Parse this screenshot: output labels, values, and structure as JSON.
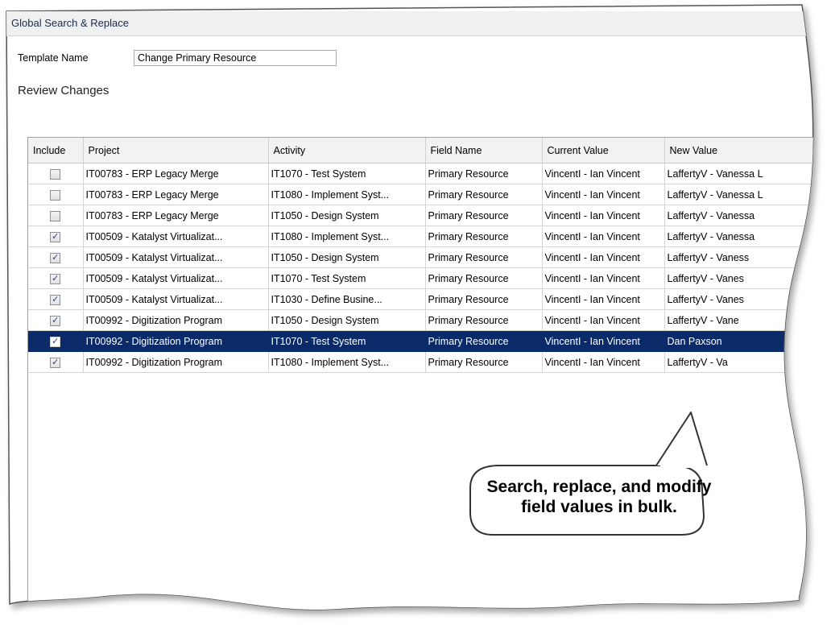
{
  "window": {
    "title": "Global Search & Replace"
  },
  "template": {
    "label": "Template Name",
    "value": "Change Primary Resource"
  },
  "review": {
    "heading": "Review Changes"
  },
  "table": {
    "columns": [
      "Include",
      "Project",
      "Activity",
      "Field Name",
      "Current Value",
      "New Value"
    ],
    "rows": [
      {
        "include": false,
        "selected": false,
        "project": "IT00783 - ERP Legacy Merge",
        "activity": "IT1070 - Test System",
        "field": "Primary Resource",
        "current": "VincentI - Ian Vincent",
        "new": "LaffertyV - Vanessa L"
      },
      {
        "include": false,
        "selected": false,
        "project": "IT00783 - ERP Legacy Merge",
        "activity": "IT1080 - Implement Syst...",
        "field": "Primary Resource",
        "current": "VincentI - Ian Vincent",
        "new": "LaffertyV - Vanessa L"
      },
      {
        "include": false,
        "selected": false,
        "project": "IT00783 - ERP Legacy Merge",
        "activity": "IT1050 - Design System",
        "field": "Primary Resource",
        "current": "VincentI - Ian Vincent",
        "new": "LaffertyV - Vanessa"
      },
      {
        "include": true,
        "selected": false,
        "project": "IT00509 - Katalyst Virtualizat...",
        "activity": "IT1080 - Implement Syst...",
        "field": "Primary Resource",
        "current": "VincentI - Ian Vincent",
        "new": "LaffertyV - Vanessa"
      },
      {
        "include": true,
        "selected": false,
        "project": "IT00509 - Katalyst Virtualizat...",
        "activity": "IT1050 - Design System",
        "field": "Primary Resource",
        "current": "VincentI - Ian Vincent",
        "new": "LaffertyV - Vaness"
      },
      {
        "include": true,
        "selected": false,
        "project": "IT00509 - Katalyst Virtualizat...",
        "activity": "IT1070 - Test System",
        "field": "Primary Resource",
        "current": "VincentI - Ian Vincent",
        "new": "LaffertyV - Vanes"
      },
      {
        "include": true,
        "selected": false,
        "project": "IT00509 - Katalyst Virtualizat...",
        "activity": "IT1030 - Define Busine...",
        "field": "Primary Resource",
        "current": "VincentI - Ian Vincent",
        "new": "LaffertyV - Vanes"
      },
      {
        "include": true,
        "selected": false,
        "project": "IT00992 - Digitization Program",
        "activity": "IT1050 - Design System",
        "field": "Primary Resource",
        "current": "VincentI - Ian Vincent",
        "new": "LaffertyV - Vane"
      },
      {
        "include": true,
        "selected": true,
        "project": "IT00992 - Digitization Program",
        "activity": "IT1070 - Test System",
        "field": "Primary Resource",
        "current": "VincentI - Ian Vincent",
        "new": "Dan Paxson"
      },
      {
        "include": true,
        "selected": false,
        "project": "IT00992 - Digitization Program",
        "activity": "IT1080 - Implement Syst...",
        "field": "Primary Resource",
        "current": "VincentI - Ian Vincent",
        "new": "LaffertyV - Va"
      }
    ]
  },
  "callout": {
    "text": "Search, replace, and modify field values in bulk."
  },
  "icons": {
    "checked": "checkbox-checked-icon",
    "unchecked": "checkbox-unchecked-icon"
  },
  "colors": {
    "selected_row": "#0a2a6a",
    "header_bg": "#f2f2f2"
  }
}
